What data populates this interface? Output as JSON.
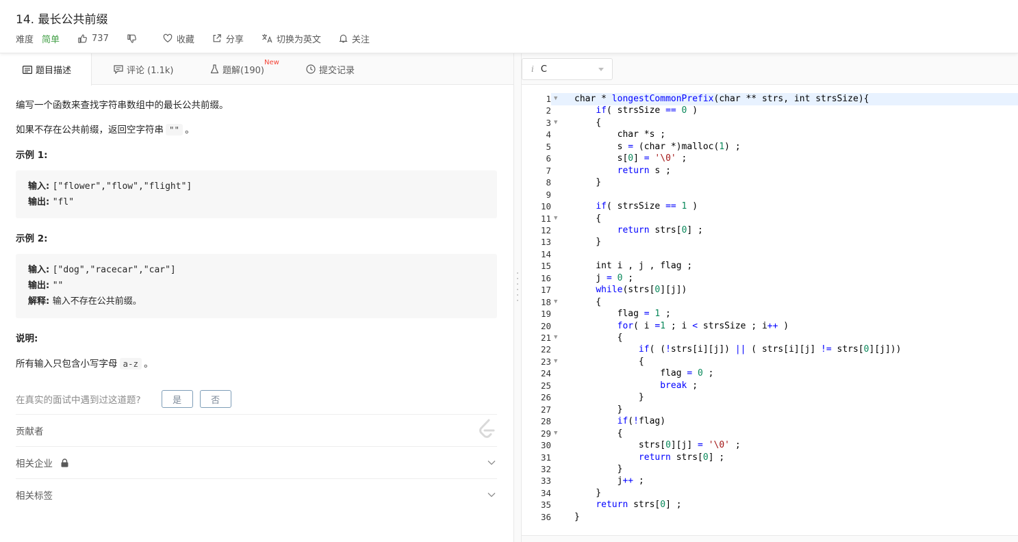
{
  "header": {
    "title": "14. 最长公共前缀",
    "difficulty_label": "难度",
    "difficulty": "简单",
    "likes": "737",
    "collect": "收藏",
    "share": "分享",
    "switch_lang": "切换为英文",
    "follow": "关注"
  },
  "tabs": [
    {
      "label": "题目描述",
      "icon": "description-icon"
    },
    {
      "label": "评论 (1.1k)",
      "icon": "comment-icon"
    },
    {
      "label": "题解(190)",
      "icon": "flask-icon",
      "badge": "New"
    },
    {
      "label": "提交记录",
      "icon": "history-icon"
    }
  ],
  "description": {
    "p1": "编写一个函数来查找字符串数组中的最长公共前缀。",
    "p2_before": "如果不存在公共前缀，返回空字符串",
    "p2_code": "\"\"",
    "p2_after": "。",
    "example1_title": "示例 1:",
    "example1": {
      "input_label": "输入: ",
      "input": "[\"flower\",\"flow\",\"flight\"]",
      "output_label": "输出: ",
      "output": "\"fl\""
    },
    "example2_title": "示例 2:",
    "example2": {
      "input_label": "输入: ",
      "input": "[\"dog\",\"racecar\",\"car\"]",
      "output_label": "输出: ",
      "output": "\"\"",
      "explain_label": "解释: ",
      "explain": "输入不存在公共前缀。"
    },
    "note_title": "说明:",
    "note_before": "所有输入只包含小写字母",
    "note_code": "a-z",
    "note_after": "。",
    "ask": "在真实的面试中遇到过这道题?",
    "yes": "是",
    "no": "否",
    "contributors": "贡献者",
    "companies": "相关企业",
    "tags": "相关标签"
  },
  "editor": {
    "language": "C",
    "lines": [
      "char * longestCommonPrefix(char ** strs, int strsSize){",
      "    if( strsSize == 0 )",
      "    {",
      "        char *s ;",
      "        s = (char *)malloc(1) ;",
      "        s[0] = '\\0' ;",
      "        return s ;",
      "    }",
      "",
      "    if( strsSize == 1 )",
      "    {",
      "        return strs[0] ;",
      "    }",
      "",
      "    int i , j , flag ;",
      "    j = 0 ;",
      "    while(strs[0][j])",
      "    {",
      "        flag = 1 ;",
      "        for( i =1 ; i < strsSize ; i++ )",
      "        {",
      "            if( (!strs[i][j]) || ( strs[i][j] != strs[0][j]))",
      "            {",
      "                flag = 0 ;",
      "                break ;",
      "            }",
      "        }",
      "        if(!flag)",
      "        {",
      "            strs[0][j] = '\\0' ;",
      "            return strs[0] ;",
      "        }",
      "        j++ ;",
      "    }",
      "    return strs[0] ;",
      "}"
    ],
    "fold_lines": [
      1,
      3,
      11,
      18,
      21,
      23,
      29
    ]
  }
}
